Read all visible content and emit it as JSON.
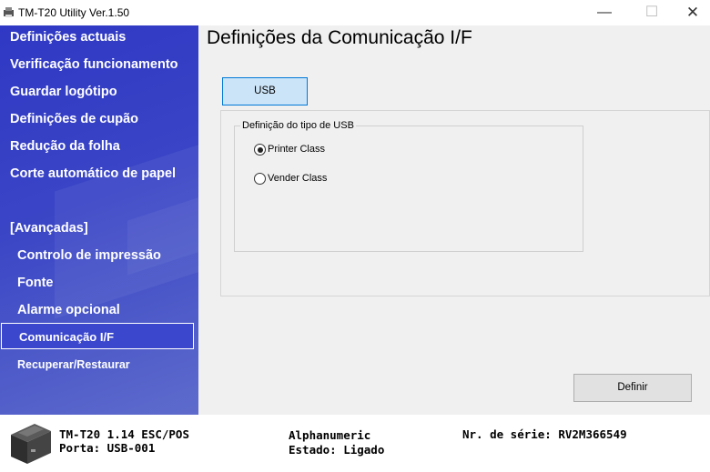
{
  "window": {
    "title": "TM-T20 Utility Ver.1.50",
    "minimize": "—",
    "maximize": "☐",
    "close": "✕"
  },
  "sidebar": {
    "items": [
      {
        "label": "Definições actuais"
      },
      {
        "label": "Verificação funcionamento"
      },
      {
        "label": "Guardar logótipo"
      },
      {
        "label": "Definições de cupão"
      },
      {
        "label": "Redução da folha"
      },
      {
        "label": "Corte automático de papel"
      }
    ],
    "section_label": "[Avançadas]",
    "advanced_items": [
      {
        "label": "Controlo de impressão"
      },
      {
        "label": "Fonte"
      },
      {
        "label": "Alarme opcional"
      },
      {
        "label": "Comunicação I/F",
        "active": true
      },
      {
        "label": "Recuperar/Restaurar"
      }
    ]
  },
  "main": {
    "title": "Definições da Comunicação I/F",
    "tab_label": "USB",
    "group_label": "Definição do tipo de USB",
    "options": [
      {
        "label": "Printer Class",
        "selected": true
      },
      {
        "label": "Vender Class",
        "selected": false
      }
    ],
    "set_button": "Definir"
  },
  "status": {
    "model": "TM-T20 1.14 ESC/POS",
    "port": "Porta: USB-001",
    "font_mode": "Alphanumeric",
    "state": "Estado: Ligado",
    "serial": "Nr. de série: RV2M366549"
  },
  "colors": {
    "sidebar_top": "#2f38c4",
    "sidebar_bottom": "#5e6bcc",
    "tab_selected_bg": "#cce4f7",
    "tab_selected_border": "#0078d7"
  },
  "icons": {
    "app": "printer-icon",
    "status_printer": "receipt-printer-icon"
  }
}
